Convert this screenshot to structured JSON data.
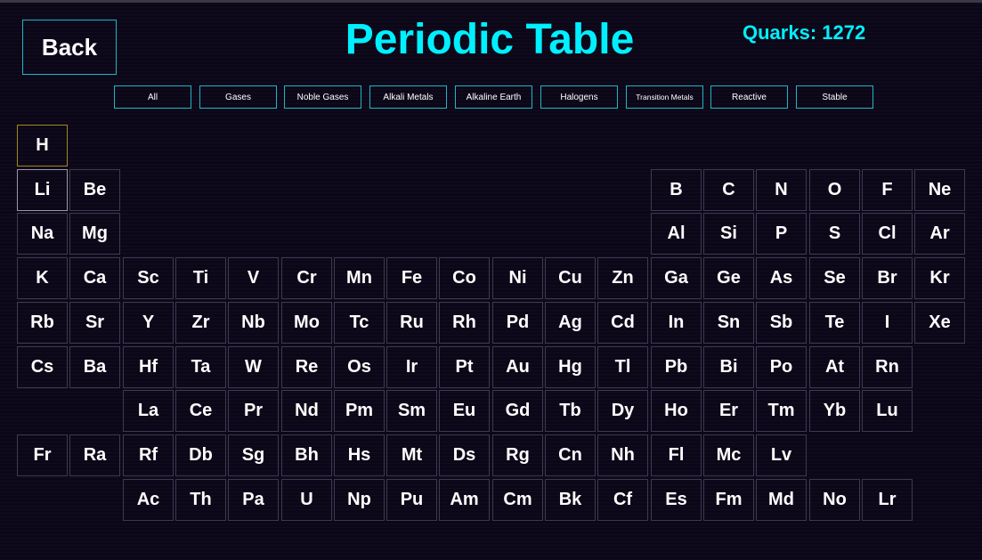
{
  "header": {
    "back_label": "Back",
    "title": "Periodic Table",
    "quarks": "Quarks: 1272"
  },
  "filters": [
    "All",
    "Gases",
    "Noble Gases",
    "Alkali Metals",
    "Alkaline Earth",
    "Halogens",
    "Transition Metals",
    "Reactive",
    "Stable"
  ],
  "table": {
    "rows": [
      [
        "H",
        "",
        "",
        "",
        "",
        "",
        "",
        "",
        "",
        "",
        "",
        "",
        "",
        "",
        "",
        "",
        "",
        ""
      ],
      [
        "Li",
        "Be",
        "",
        "",
        "",
        "",
        "",
        "",
        "",
        "",
        "",
        "",
        "B",
        "C",
        "N",
        "O",
        "F",
        "Ne"
      ],
      [
        "Na",
        "Mg",
        "",
        "",
        "",
        "",
        "",
        "",
        "",
        "",
        "",
        "",
        "Al",
        "Si",
        "P",
        "S",
        "Cl",
        "Ar"
      ],
      [
        "K",
        "Ca",
        "Sc",
        "Ti",
        "V",
        "Cr",
        "Mn",
        "Fe",
        "Co",
        "Ni",
        "Cu",
        "Zn",
        "Ga",
        "Ge",
        "As",
        "Se",
        "Br",
        "Kr"
      ],
      [
        "Rb",
        "Sr",
        "Y",
        "Zr",
        "Nb",
        "Mo",
        "Tc",
        "Ru",
        "Rh",
        "Pd",
        "Ag",
        "Cd",
        "In",
        "Sn",
        "Sb",
        "Te",
        "I",
        "Xe"
      ],
      [
        "Cs",
        "Ba",
        "Hf",
        "Ta",
        "W",
        "Re",
        "Os",
        "Ir",
        "Pt",
        "Au",
        "Hg",
        "Tl",
        "Pb",
        "Bi",
        "Po",
        "At",
        "Rn",
        ""
      ],
      [
        "",
        "",
        "La",
        "Ce",
        "Pr",
        "Nd",
        "Pm",
        "Sm",
        "Eu",
        "Gd",
        "Tb",
        "Dy",
        "Ho",
        "Er",
        "Tm",
        "Yb",
        "Lu",
        ""
      ],
      [
        "Fr",
        "Ra",
        "Rf",
        "Db",
        "Sg",
        "Bh",
        "Hs",
        "Mt",
        "Ds",
        "Rg",
        "Cn",
        "Nh",
        "Fl",
        "Mc",
        "Lv",
        "",
        "",
        ""
      ],
      [
        "",
        "",
        "Ac",
        "Th",
        "Pa",
        "U",
        "Np",
        "Pu",
        "Am",
        "Cm",
        "Bk",
        "Cf",
        "Es",
        "Fm",
        "Md",
        "No",
        "Lr",
        ""
      ]
    ],
    "highlighted": [
      "H",
      "Li"
    ]
  },
  "colors": {
    "background": "#0c0718",
    "accent": "#00f0ff",
    "button_border": "#1fb5c8",
    "cell_border": "#3c3a52",
    "highlight_gold": "#a08a1c"
  }
}
